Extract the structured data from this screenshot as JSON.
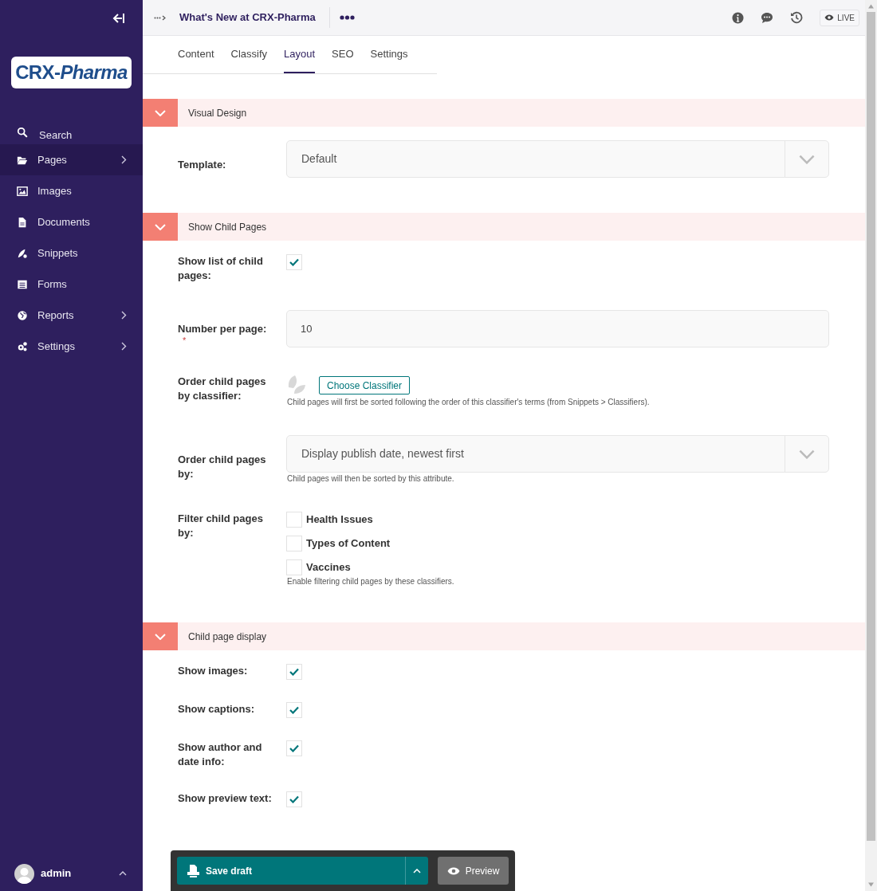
{
  "sidebar": {
    "logo": "CRX-*Pharma*",
    "items": [
      {
        "label": "Search",
        "submenu": false,
        "selected": false
      },
      {
        "label": "Pages",
        "submenu": true,
        "selected": true
      },
      {
        "label": "Images",
        "submenu": false,
        "selected": false
      },
      {
        "label": "Documents",
        "submenu": false,
        "selected": false
      },
      {
        "label": "Snippets",
        "submenu": false,
        "selected": false
      },
      {
        "label": "Forms",
        "submenu": false,
        "selected": false
      },
      {
        "label": "Reports",
        "submenu": true,
        "selected": false
      },
      {
        "label": "Settings",
        "submenu": true,
        "selected": false
      }
    ],
    "user": "admin"
  },
  "header": {
    "title": "What's New at CRX-Pharma",
    "live": "LIVE"
  },
  "tabs": [
    {
      "label": "Content",
      "selected": false
    },
    {
      "label": "Classify",
      "selected": false
    },
    {
      "label": "Layout",
      "selected": true
    },
    {
      "label": "SEO",
      "selected": false
    },
    {
      "label": "Settings",
      "selected": false
    }
  ],
  "sections": [
    {
      "title": "Visual Design",
      "expanded": true,
      "fields": [
        {
          "kind": "select",
          "label": "Template:",
          "value": "Default"
        }
      ]
    },
    {
      "title": "Show Child Pages",
      "expanded": true,
      "fields": [
        {
          "kind": "checkbox",
          "label": "Show list of child pages:",
          "checked": true
        },
        {
          "kind": "text",
          "label": "Number per page:",
          "required_mark": "*",
          "value": "10"
        },
        {
          "kind": "classifier",
          "label": "Order child pages by classifier:",
          "button": "Choose Classifier",
          "help": "Child pages will first be sorted following the order of this classifier's terms (from Snippets > Classifiers)."
        },
        {
          "kind": "select",
          "label": "Order child pages by:",
          "value": "Display publish date, newest first",
          "help": "Child pages will then be sorted by this attribute."
        },
        {
          "kind": "checkbox_group",
          "label": "Filter child pages by:",
          "options": [
            {
              "label": "Health Issues",
              "checked": false
            },
            {
              "label": "Types of Content",
              "checked": false
            },
            {
              "label": "Vaccines",
              "checked": false
            }
          ],
          "help": "Enable filtering child pages by these classifiers."
        }
      ]
    },
    {
      "title": "Child page display",
      "expanded": true,
      "fields": [
        {
          "kind": "checkbox",
          "label": "Show images:",
          "checked": true
        },
        {
          "kind": "checkbox",
          "label": "Show captions:",
          "checked": true
        },
        {
          "kind": "checkbox",
          "label": "Show author and date info:",
          "checked": true
        },
        {
          "kind": "checkbox",
          "label": "Show preview text:",
          "checked": true
        }
      ]
    }
  ],
  "footer": {
    "save": "Save draft",
    "preview": "Preview"
  }
}
